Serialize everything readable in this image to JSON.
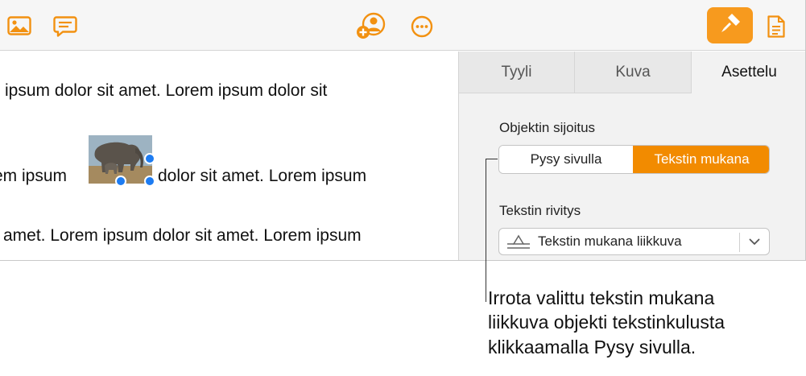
{
  "toolbar": {
    "icons": [
      "media-icon",
      "comment-icon",
      "collaborate-icon",
      "more-icon",
      "format-brush-icon",
      "document-icon"
    ],
    "accent": "#f79a1e"
  },
  "document": {
    "line1": "ipsum dolor sit amet.  Lorem ipsum dolor sit",
    "line2a": "em ipsum",
    "line2b": "dolor sit amet. Lorem ipsum",
    "line3": "amet. Lorem ipsum dolor sit amet. Lorem ipsum"
  },
  "panel": {
    "tabs": [
      {
        "label": "Tyyli"
      },
      {
        "label": "Kuva"
      },
      {
        "label": "Asettelu",
        "selected": true
      }
    ],
    "placement_label": "Objektin sijoitus",
    "placement_options": [
      "Pysy sivulla",
      "Tekstin mukana"
    ],
    "placement_selected": "Tekstin mukana",
    "wrap_label": "Tekstin rivitys",
    "wrap_value": "Tekstin mukana liikkuva"
  },
  "callout": {
    "lines": [
      "Irrota valittu tekstin mukana",
      "liikkuva objekti tekstinkulusta",
      "klikkaamalla Pysy sivulla."
    ]
  },
  "colors": {
    "selection_handle": "#1d7cf2",
    "segment_selected": "#f28b00"
  }
}
